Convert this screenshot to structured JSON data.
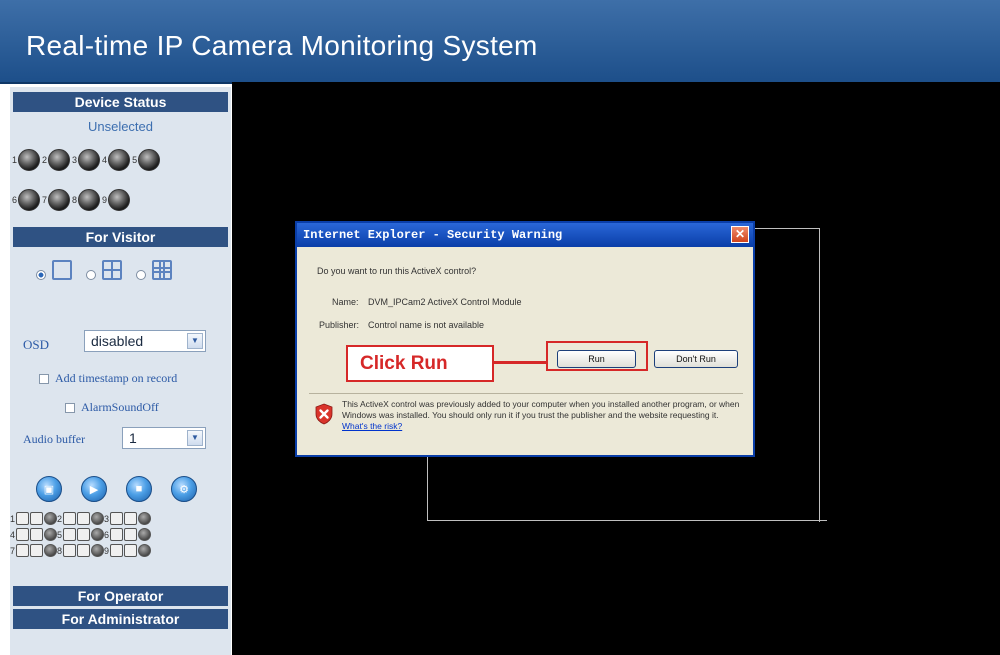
{
  "header": {
    "title": "Real-time IP Camera Monitoring System"
  },
  "sidebar": {
    "device_status": {
      "label": "Device Status",
      "state": "Unselected"
    },
    "camera_numbers_row1": [
      "1",
      "2",
      "3",
      "4",
      "5"
    ],
    "camera_numbers_row2": [
      "6",
      "7",
      "8",
      "9"
    ],
    "for_visitor": {
      "label": "For Visitor"
    },
    "osd": {
      "label": "OSD",
      "value": "disabled"
    },
    "add_timestamp": "Add timestamp on record",
    "alarm_sound_off": "AlarmSoundOff",
    "audio_buffer": {
      "label": "Audio buffer",
      "value": "1"
    },
    "record_numbers": [
      "1",
      "2",
      "3",
      "4",
      "5",
      "6",
      "7",
      "8",
      "9"
    ],
    "for_operator": "For Operator",
    "for_administrator": "For Administrator"
  },
  "dialog": {
    "title": "Internet Explorer - Security Warning",
    "question": "Do you want to run this ActiveX control?",
    "name_label": "Name:",
    "name_value": "DVM_IPCam2 ActiveX Control Module",
    "publisher_label": "Publisher:",
    "publisher_value": "Control name is not available",
    "run_button": "Run",
    "dont_run_button": "Don't Run",
    "warning_text": "This ActiveX control was previously added to your computer when you installed another program, or when Windows was installed. You should only run it if you trust the publisher and the website requesting it.",
    "risk_link": "What's the risk?"
  },
  "callout": {
    "text": "Click Run"
  },
  "colors": {
    "header": "#1d4f8a",
    "section": "#2f5283",
    "accent_red": "#d62828",
    "video_bg": "#000000"
  }
}
